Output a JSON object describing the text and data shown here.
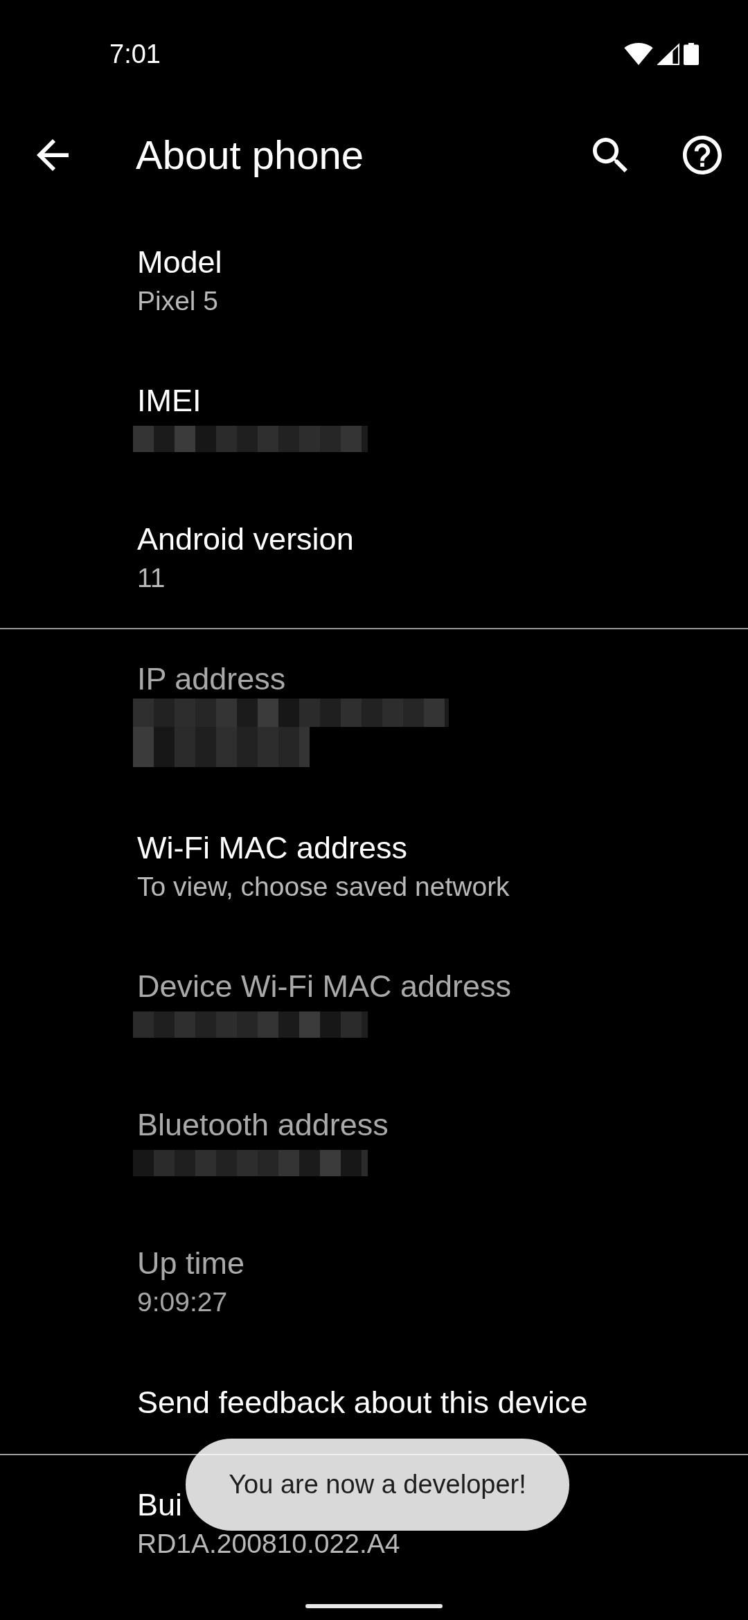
{
  "status_bar": {
    "time": "7:01"
  },
  "app_bar": {
    "title": "About phone"
  },
  "groups": [
    {
      "items": [
        {
          "kind": "value",
          "title": "Model",
          "summary": "Pixel 5",
          "disabled": false
        },
        {
          "kind": "masked",
          "title": "IMEI",
          "disabled": false
        },
        {
          "kind": "value",
          "title": "Android version",
          "summary": "11",
          "disabled": false
        }
      ]
    },
    {
      "items": [
        {
          "kind": "masked_multiline",
          "title": "IP address",
          "disabled": true
        },
        {
          "kind": "value",
          "title": "Wi-Fi MAC address",
          "summary": "To view, choose saved network",
          "disabled": false
        },
        {
          "kind": "masked",
          "title": "Device Wi-Fi MAC address",
          "disabled": true
        },
        {
          "kind": "masked",
          "title": "Bluetooth address",
          "disabled": true
        },
        {
          "kind": "value",
          "title": "Up time",
          "summary": "9:09:27",
          "disabled": true
        },
        {
          "kind": "action",
          "title": "Send feedback about this device",
          "disabled": false
        }
      ]
    },
    {
      "items": [
        {
          "kind": "value",
          "title": "Bui",
          "summary": "RD1A.200810.022.A4",
          "disabled": false
        }
      ]
    }
  ],
  "toast": {
    "text": "You are now a developer!"
  }
}
